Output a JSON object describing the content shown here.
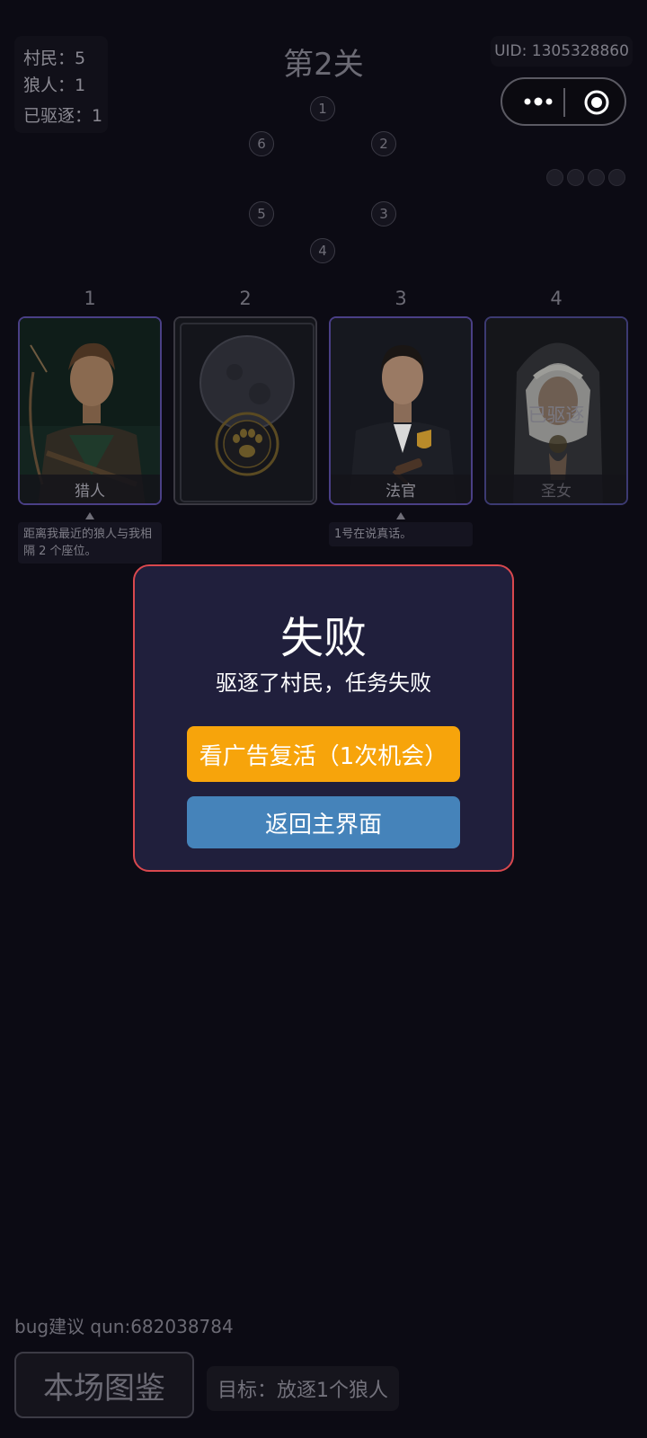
{
  "stats": {
    "villagers": "村民：5",
    "werewolves": "狼人：1",
    "expelled": "已驱逐：1"
  },
  "level_title": "第2关",
  "uid": "UID: 1305328860",
  "capsule": {
    "more_icon": "more-dots-icon",
    "close_icon": "target-icon"
  },
  "seats": [
    "1",
    "2",
    "3",
    "4",
    "5",
    "6"
  ],
  "cards": [
    {
      "number": "1",
      "name": "猎人",
      "tip": "距离我最近的狼人与我相隔 2 个座位。"
    },
    {
      "number": "2",
      "name": ""
    },
    {
      "number": "3",
      "name": "法官",
      "tip": "1号在说真话。"
    },
    {
      "number": "4",
      "name": "圣女",
      "badge": "已驱逐"
    }
  ],
  "modal": {
    "title": "失败",
    "message": "驱逐了村民，任务失败",
    "revive_label": "看广告复活（1次机会）",
    "home_label": "返回主界面"
  },
  "footer": {
    "bug": "bug建议 qun:682038784",
    "codex_label": "本场图鉴",
    "goal": "目标：放逐1个狼人"
  },
  "colors": {
    "background": "#0c0b14",
    "modal_bg": "#201f3c",
    "modal_border": "#d9484e",
    "revive_button": "#f7a40b",
    "home_button": "#4583ba",
    "card_border_purple": "#4a3f86"
  }
}
